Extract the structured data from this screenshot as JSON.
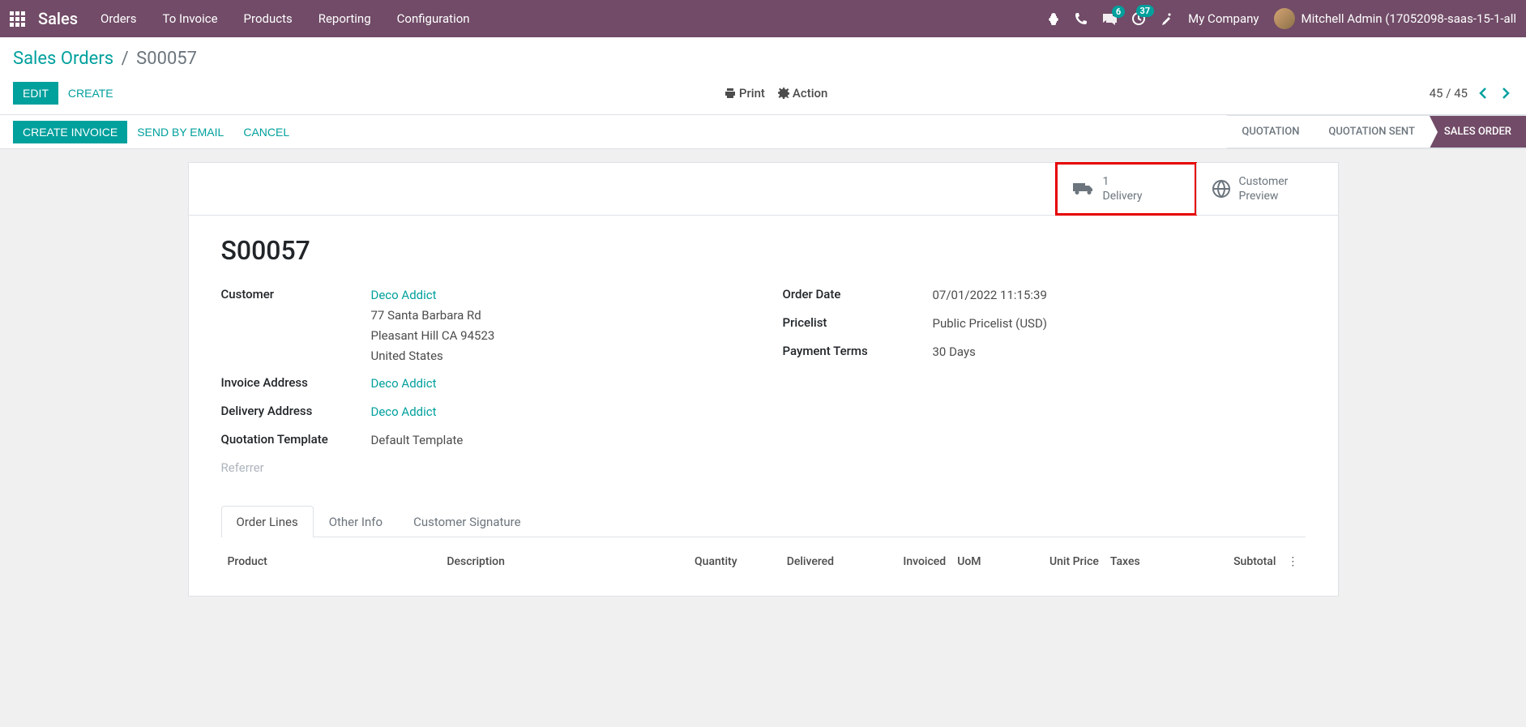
{
  "nav": {
    "brand": "Sales",
    "menu": [
      "Orders",
      "To Invoice",
      "Products",
      "Reporting",
      "Configuration"
    ],
    "messages_badge": "6",
    "activity_badge": "37",
    "company": "My Company",
    "user": "Mitchell Admin (17052098-saas-15-1-all"
  },
  "breadcrumb": {
    "parent": "Sales Orders",
    "current": "S00057"
  },
  "controls": {
    "edit": "Edit",
    "create": "Create",
    "print": "Print",
    "action": "Action",
    "pager": "45 / 45"
  },
  "status": {
    "create_invoice": "Create Invoice",
    "send_email": "Send by Email",
    "cancel": "Cancel",
    "steps": [
      "Quotation",
      "Quotation Sent",
      "Sales Order"
    ]
  },
  "stat": {
    "delivery_count": "1",
    "delivery_label": "Delivery",
    "preview_line1": "Customer",
    "preview_line2": "Preview"
  },
  "order": {
    "name": "S00057",
    "labels": {
      "customer": "Customer",
      "invoice_addr": "Invoice Address",
      "delivery_addr": "Delivery Address",
      "quote_tmpl": "Quotation Template",
      "referrer": "Referrer",
      "order_date": "Order Date",
      "pricelist": "Pricelist",
      "payment_terms": "Payment Terms"
    },
    "customer_name": "Deco Addict",
    "customer_addr1": "77 Santa Barbara Rd",
    "customer_addr2": "Pleasant Hill CA 94523",
    "customer_addr3": "United States",
    "invoice_addr": "Deco Addict",
    "delivery_addr": "Deco Addict",
    "quote_tmpl": "Default Template",
    "order_date": "07/01/2022 11:15:39",
    "pricelist": "Public Pricelist (USD)",
    "payment_terms": "30 Days"
  },
  "tabs": [
    "Order Lines",
    "Other Info",
    "Customer Signature"
  ],
  "table": {
    "headers": {
      "product": "Product",
      "description": "Description",
      "quantity": "Quantity",
      "delivered": "Delivered",
      "invoiced": "Invoiced",
      "uom": "UoM",
      "unit_price": "Unit Price",
      "taxes": "Taxes",
      "subtotal": "Subtotal"
    }
  }
}
